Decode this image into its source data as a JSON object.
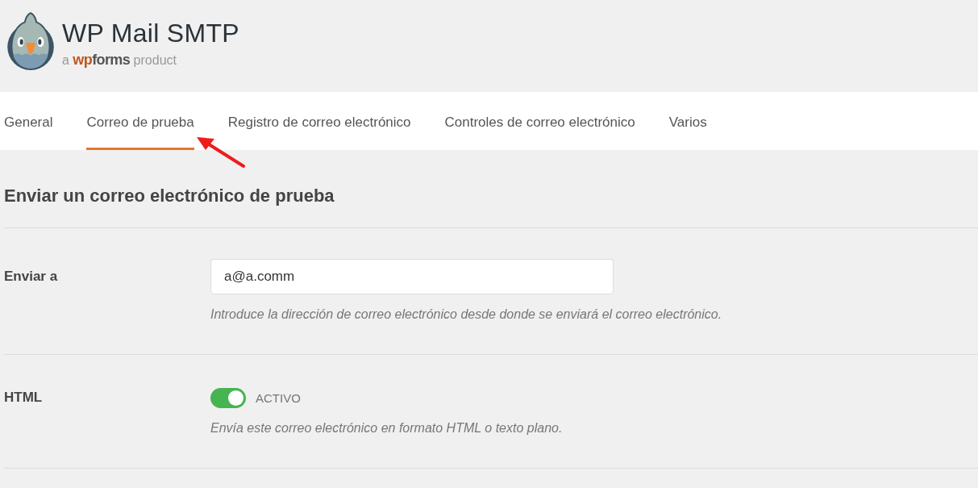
{
  "header": {
    "title": "WP Mail SMTP",
    "tagline": {
      "prefix": "a",
      "brand": [
        {
          "text": "wp",
          "color": "#c0561c"
        },
        {
          "text": "forms",
          "color": "#555555"
        }
      ],
      "suffix": "product"
    }
  },
  "tabs": [
    {
      "label": "General",
      "selected": false
    },
    {
      "label": "Correo de prueba",
      "selected": true
    },
    {
      "label": "Registro de correo electrónico",
      "selected": false
    },
    {
      "label": "Controles de correo electrónico",
      "selected": false
    },
    {
      "label": "Varios",
      "selected": false
    }
  ],
  "page_title": "Enviar un correo electrónico de prueba",
  "fields": [
    {
      "kind": "text",
      "label": "Enviar a",
      "value": "a@a.comm",
      "description": "Introduce la dirección de correo electrónico desde donde se enviará el correo electrónico."
    },
    {
      "kind": "toggle",
      "label": "HTML",
      "on": true,
      "state_label": "ACTIVO",
      "description": "Envía este correo electrónico en formato HTML o texto plano."
    }
  ]
}
